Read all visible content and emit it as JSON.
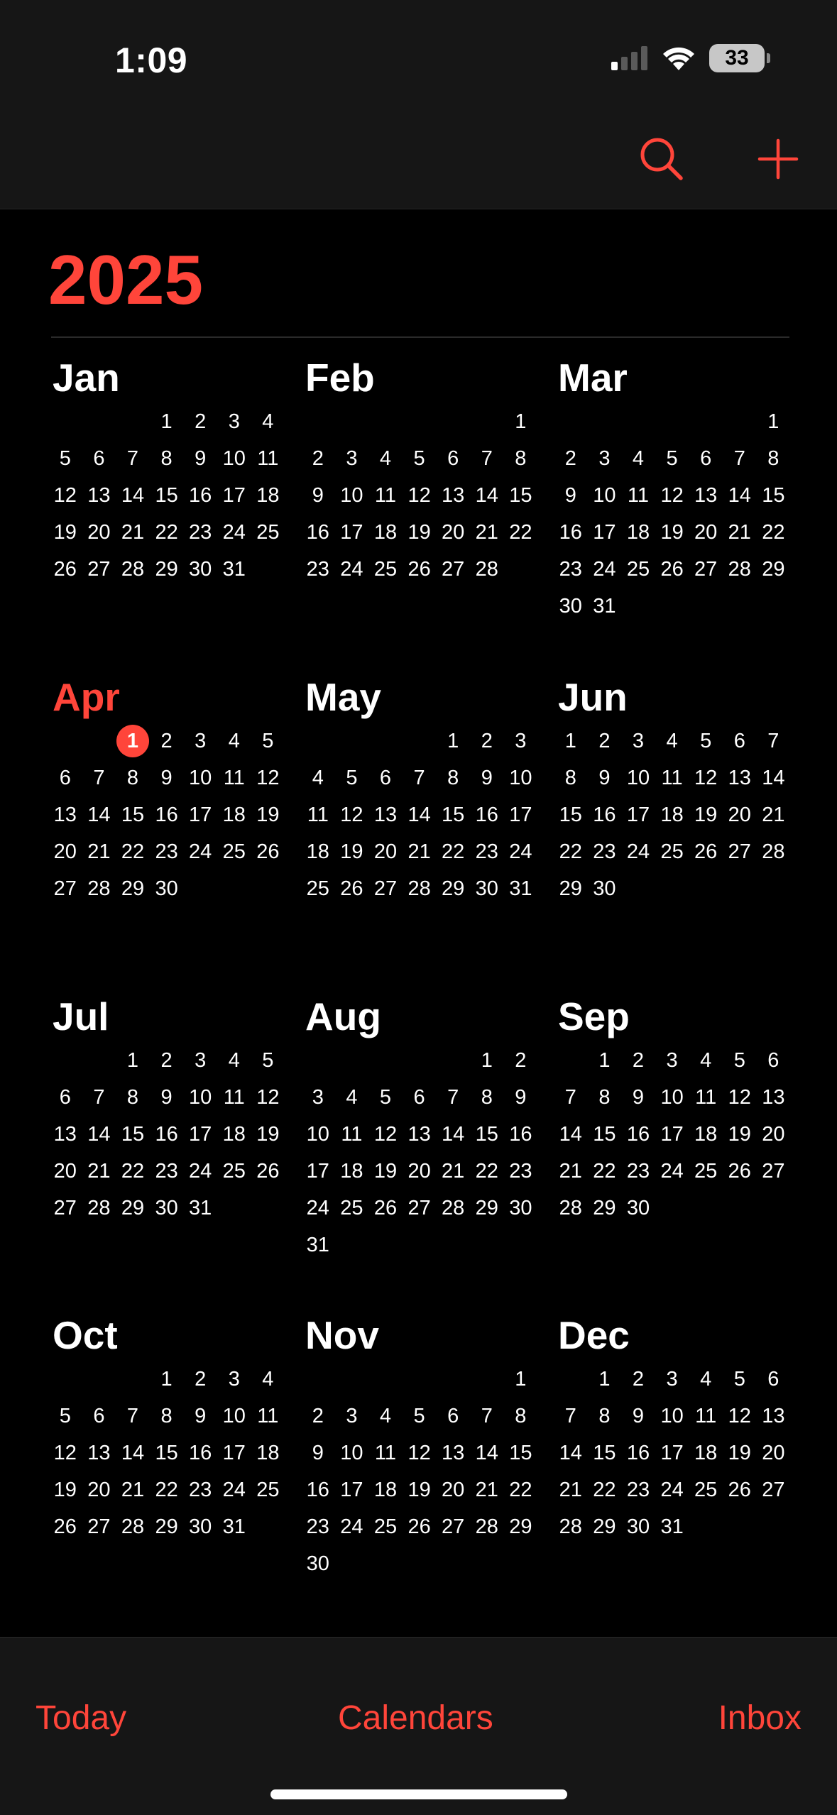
{
  "status_bar": {
    "time": "1:09",
    "battery": "33",
    "icons": [
      "cellular-signal-icon",
      "wifi-icon",
      "battery-icon"
    ]
  },
  "toolbar": {
    "icons": [
      "search-icon",
      "plus-icon"
    ]
  },
  "year": "2025",
  "accent_color": "#ff453a",
  "today": {
    "month_index": 3,
    "day": 1
  },
  "months": [
    {
      "name": "Jan",
      "offset": 3,
      "days": 31
    },
    {
      "name": "Feb",
      "offset": 6,
      "days": 28
    },
    {
      "name": "Mar",
      "offset": 6,
      "days": 31
    },
    {
      "name": "Apr",
      "offset": 2,
      "days": 30
    },
    {
      "name": "May",
      "offset": 4,
      "days": 31
    },
    {
      "name": "Jun",
      "offset": 0,
      "days": 30
    },
    {
      "name": "Jul",
      "offset": 2,
      "days": 31
    },
    {
      "name": "Aug",
      "offset": 5,
      "days": 31
    },
    {
      "name": "Sep",
      "offset": 1,
      "days": 30
    },
    {
      "name": "Oct",
      "offset": 3,
      "days": 31
    },
    {
      "name": "Nov",
      "offset": 6,
      "days": 30
    },
    {
      "name": "Dec",
      "offset": 1,
      "days": 31
    }
  ],
  "tabs": {
    "today": "Today",
    "calendars": "Calendars",
    "inbox": "Inbox"
  }
}
